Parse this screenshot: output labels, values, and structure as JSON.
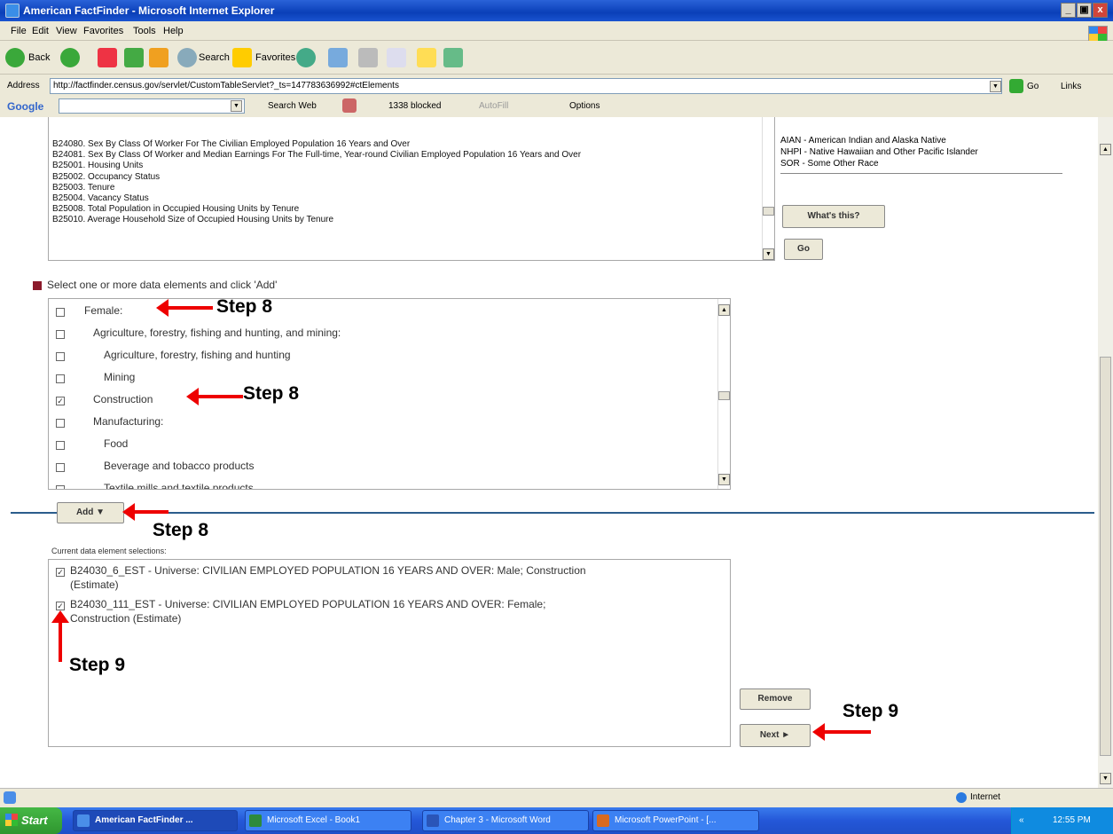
{
  "window": {
    "title": "American FactFinder - Microsoft Internet Explorer",
    "controls": [
      "_",
      "▣",
      "x"
    ]
  },
  "menu": [
    "File",
    "Edit",
    "View",
    "Favorites",
    "Tools",
    "Help"
  ],
  "toolbar": {
    "back": "Back",
    "search": "Search",
    "favorites": "Favorites"
  },
  "address": {
    "label": "Address",
    "url": "http://factfinder.census.gov/servlet/CustomTableServlet?_ts=147783636992#ctElements",
    "go": "Go",
    "links": "Links"
  },
  "google": {
    "label": "Google",
    "search_web": "Search Web",
    "blocked": "1338 blocked",
    "autofill": "AutoFill",
    "options": "Options"
  },
  "tables_list": [
    "B24080. Sex By Class Of Worker For The Civilian Employed Population 16 Years and Over",
    "B24081. Sex By Class Of Worker and Median Earnings For The Full-time, Year-round Civilian Employed Population 16 Years and Over",
    "B25001. Housing Units",
    "B25002. Occupancy Status",
    "B25003. Tenure",
    "B25004. Vacancy Status",
    "B25008. Total Population in Occupied Housing Units by Tenure",
    "B25010. Average Household Size of Occupied Housing Units by Tenure"
  ],
  "race_legend": [
    "AIAN - American Indian and Alaska Native",
    "NHPI - Native Hawaiian and Other Pacific Islander",
    "SOR - Some Other Race"
  ],
  "whats_this": "What's this?",
  "go_button": "Go",
  "select_instruction": "Select one or more data elements and click 'Add'",
  "elements": [
    {
      "label": "Female:",
      "checked": false,
      "indent": 0
    },
    {
      "label": "Agriculture, forestry, fishing and hunting, and mining:",
      "checked": false,
      "indent": 1
    },
    {
      "label": "Agriculture, forestry, fishing and hunting",
      "checked": false,
      "indent": 2
    },
    {
      "label": "Mining",
      "checked": false,
      "indent": 2
    },
    {
      "label": "Construction",
      "checked": true,
      "indent": 1
    },
    {
      "label": "Manufacturing:",
      "checked": false,
      "indent": 1
    },
    {
      "label": "Food",
      "checked": false,
      "indent": 2
    },
    {
      "label": "Beverage and tobacco products",
      "checked": false,
      "indent": 2
    },
    {
      "label": "Textile mills and textile products",
      "checked": false,
      "indent": 2
    }
  ],
  "add_button": "Add ▼",
  "current_label": "Current data element selections:",
  "selections": [
    {
      "line1": "B24030_6_EST - Universe: CIVILIAN EMPLOYED POPULATION 16 YEARS AND OVER: Male; Construction",
      "line2": "(Estimate)",
      "checked": true
    },
    {
      "line1": "B24030_111_EST - Universe: CIVILIAN EMPLOYED POPULATION 16 YEARS AND OVER: Female;",
      "line2": "Construction (Estimate)",
      "checked": true
    }
  ],
  "remove_button": "Remove",
  "next_button": "Next ►",
  "annotations": {
    "step8": "Step 8",
    "step9": "Step 9"
  },
  "status": {
    "zone": "Internet"
  },
  "taskbar": {
    "start": "Start",
    "tasks": [
      "American FactFinder ...",
      "Microsoft Excel - Book1",
      "Chapter 3 - Microsoft Word",
      "Microsoft PowerPoint - [..."
    ],
    "time": "12:55 PM"
  },
  "colors": {
    "accent_line": "#2b5d8c",
    "bullet": "#8b1a2b",
    "arrow": "#e00000"
  }
}
